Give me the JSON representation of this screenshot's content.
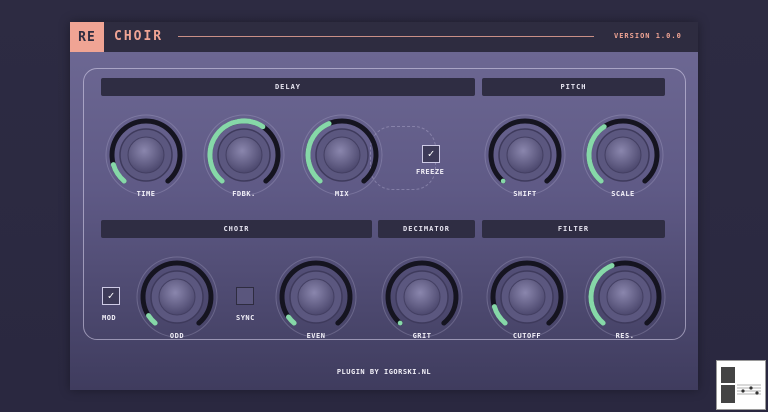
{
  "header": {
    "logo": "RE",
    "title": "CHOIR",
    "version": "VERSION 1.0.0"
  },
  "sections": {
    "delay": "DELAY",
    "pitch": "PITCH",
    "choir": "CHOIR",
    "decimator": "DECIMATOR",
    "filter": "FILTER"
  },
  "knobs": {
    "time": {
      "label": "TIME",
      "value": 0.12
    },
    "fdbk": {
      "label": "FDBK.",
      "value": 0.62
    },
    "mix": {
      "label": "MIX",
      "value": 0.42
    },
    "shift": {
      "label": "SHIFT",
      "value": 0.0
    },
    "scale": {
      "label": "SCALE",
      "value": 0.38
    },
    "odd": {
      "label": "ODD",
      "value": 0.06
    },
    "even": {
      "label": "EVEN",
      "value": 0.05
    },
    "grit": {
      "label": "GRIT",
      "value": 0.0
    },
    "cutoff": {
      "label": "CUTOFF",
      "value": 0.12
    },
    "res": {
      "label": "RES.",
      "value": 0.42
    }
  },
  "checkboxes": {
    "freeze": {
      "label": "FREEZE",
      "checked": true
    },
    "mod": {
      "label": "MOD",
      "checked": true
    },
    "sync": {
      "label": "SYNC",
      "checked": false
    }
  },
  "footer": "PLUGIN BY IGORSKI.NL",
  "colors": {
    "accent": "#86d8a8",
    "logo_bg": "#f0a494",
    "bar_bg": "#2f2d43"
  }
}
